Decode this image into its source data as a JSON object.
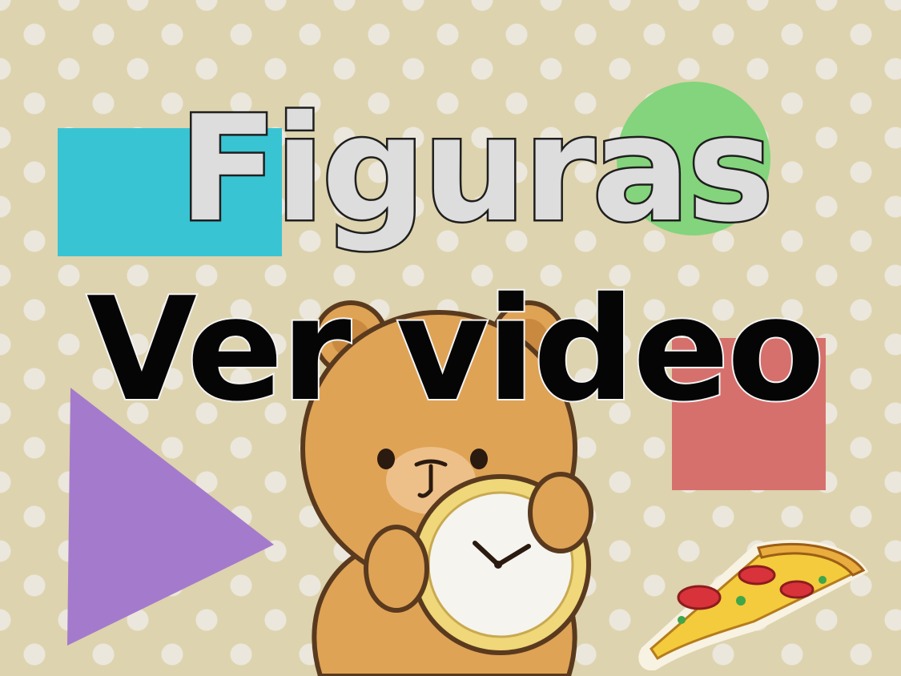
{
  "title": "Figuras",
  "subtitle": "Ver video",
  "colors": {
    "background": "#ddd3ae",
    "dots": "#ece7dc",
    "square": "#39c4d4",
    "circle": "#83d47c",
    "red_square": "#d6706d",
    "triangle": "#a47bcc",
    "bear_fur": "#dfa356",
    "clock_rim": "#efd77a",
    "pizza_crust": "#e9ac3e",
    "title_fill": "#dddddd",
    "subtitle_fill": "#050505"
  },
  "icons": {
    "bear": "bear-with-clock-icon",
    "pizza": "pizza-slice-icon"
  }
}
